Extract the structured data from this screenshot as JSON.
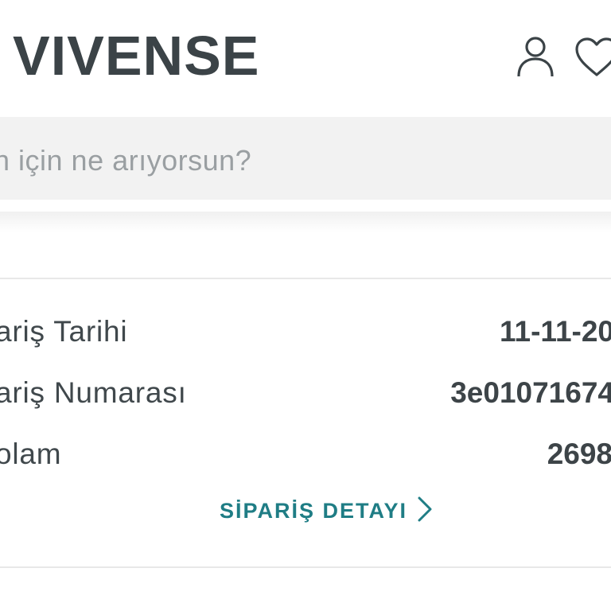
{
  "header": {
    "logo_text": "VIVENSE",
    "icons": [
      "user-icon",
      "heart-icon"
    ]
  },
  "search": {
    "placeholder": "n için ne arıyorsun?"
  },
  "order": {
    "rows": [
      {
        "label": "ariş Tarihi",
        "value": "11-11-20"
      },
      {
        "label": "ariş Numarası",
        "value": "3e01071674"
      },
      {
        "label": "olam",
        "value": "2698"
      }
    ],
    "detail_link_label": "SİPARİŞ DETAYI"
  },
  "colors": {
    "brand_text": "#3b4347",
    "link": "#1f7d85",
    "search_bg": "#f2f2f2"
  }
}
